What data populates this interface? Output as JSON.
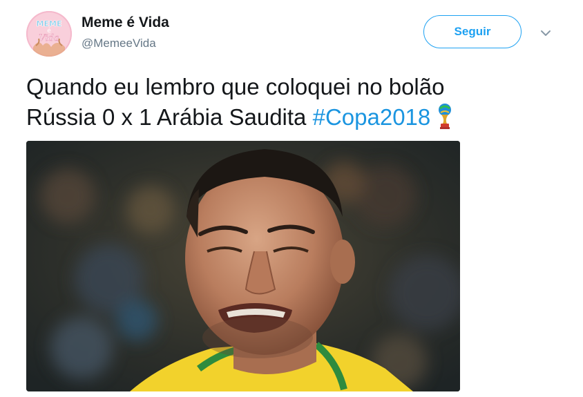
{
  "author": {
    "display_name": "Meme é Vida",
    "handle": "@MemeeVida",
    "avatar_text_top": "MEME",
    "avatar_text_mid": "é",
    "avatar_text_bottom": "Vida"
  },
  "actions": {
    "follow_label": "Seguir",
    "caret_icon": "chevron-down-icon"
  },
  "tweet": {
    "line1": "Quando eu lembro que coloquei no bolão",
    "line2_text": "Rússia 0 x 1 Arábia Saudita ",
    "hashtag": "#Copa2018",
    "emoji_icon": "world-cup-trophy-icon"
  },
  "media": {
    "icon": "crying-player-photo"
  },
  "colors": {
    "accent": "#1da1f2",
    "hashtag": "#1b95e0",
    "text": "#14171a",
    "secondary": "#657786"
  }
}
